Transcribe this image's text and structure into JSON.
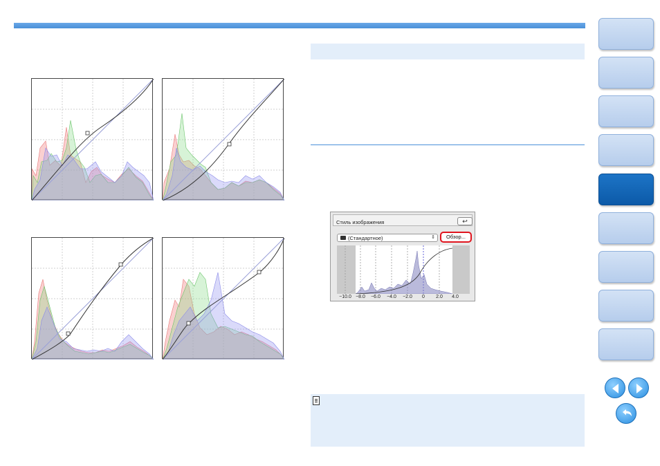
{
  "dialog": {
    "title": "Стиль изображения",
    "undo_symbol": "↩",
    "style_value": "(Стандартное)",
    "select_arrows": "⇕",
    "browse_label": "Обзор...",
    "ticks": [
      "−10.0",
      "−8.0",
      "−6.0",
      "−4.0",
      "−2.0",
      "0",
      "2.0",
      "4.0"
    ]
  },
  "nav": {
    "items": [
      {
        "id": "nav-1",
        "active": false
      },
      {
        "id": "nav-2",
        "active": false
      },
      {
        "id": "nav-3",
        "active": false
      },
      {
        "id": "nav-4",
        "active": false
      },
      {
        "id": "nav-5",
        "active": true
      },
      {
        "id": "nav-6",
        "active": false
      },
      {
        "id": "nav-7",
        "active": false
      },
      {
        "id": "nav-8",
        "active": false
      },
      {
        "id": "nav-9",
        "active": false
      }
    ],
    "prev_icon": "left-arrow-icon",
    "next_icon": "right-arrow-icon",
    "back_icon": "return-icon"
  },
  "colors": {
    "accent": "#4a90d9",
    "nav_active": "#0c5aa8",
    "highlight": "#e0141e",
    "panel_bg": "#e3eefa"
  }
}
